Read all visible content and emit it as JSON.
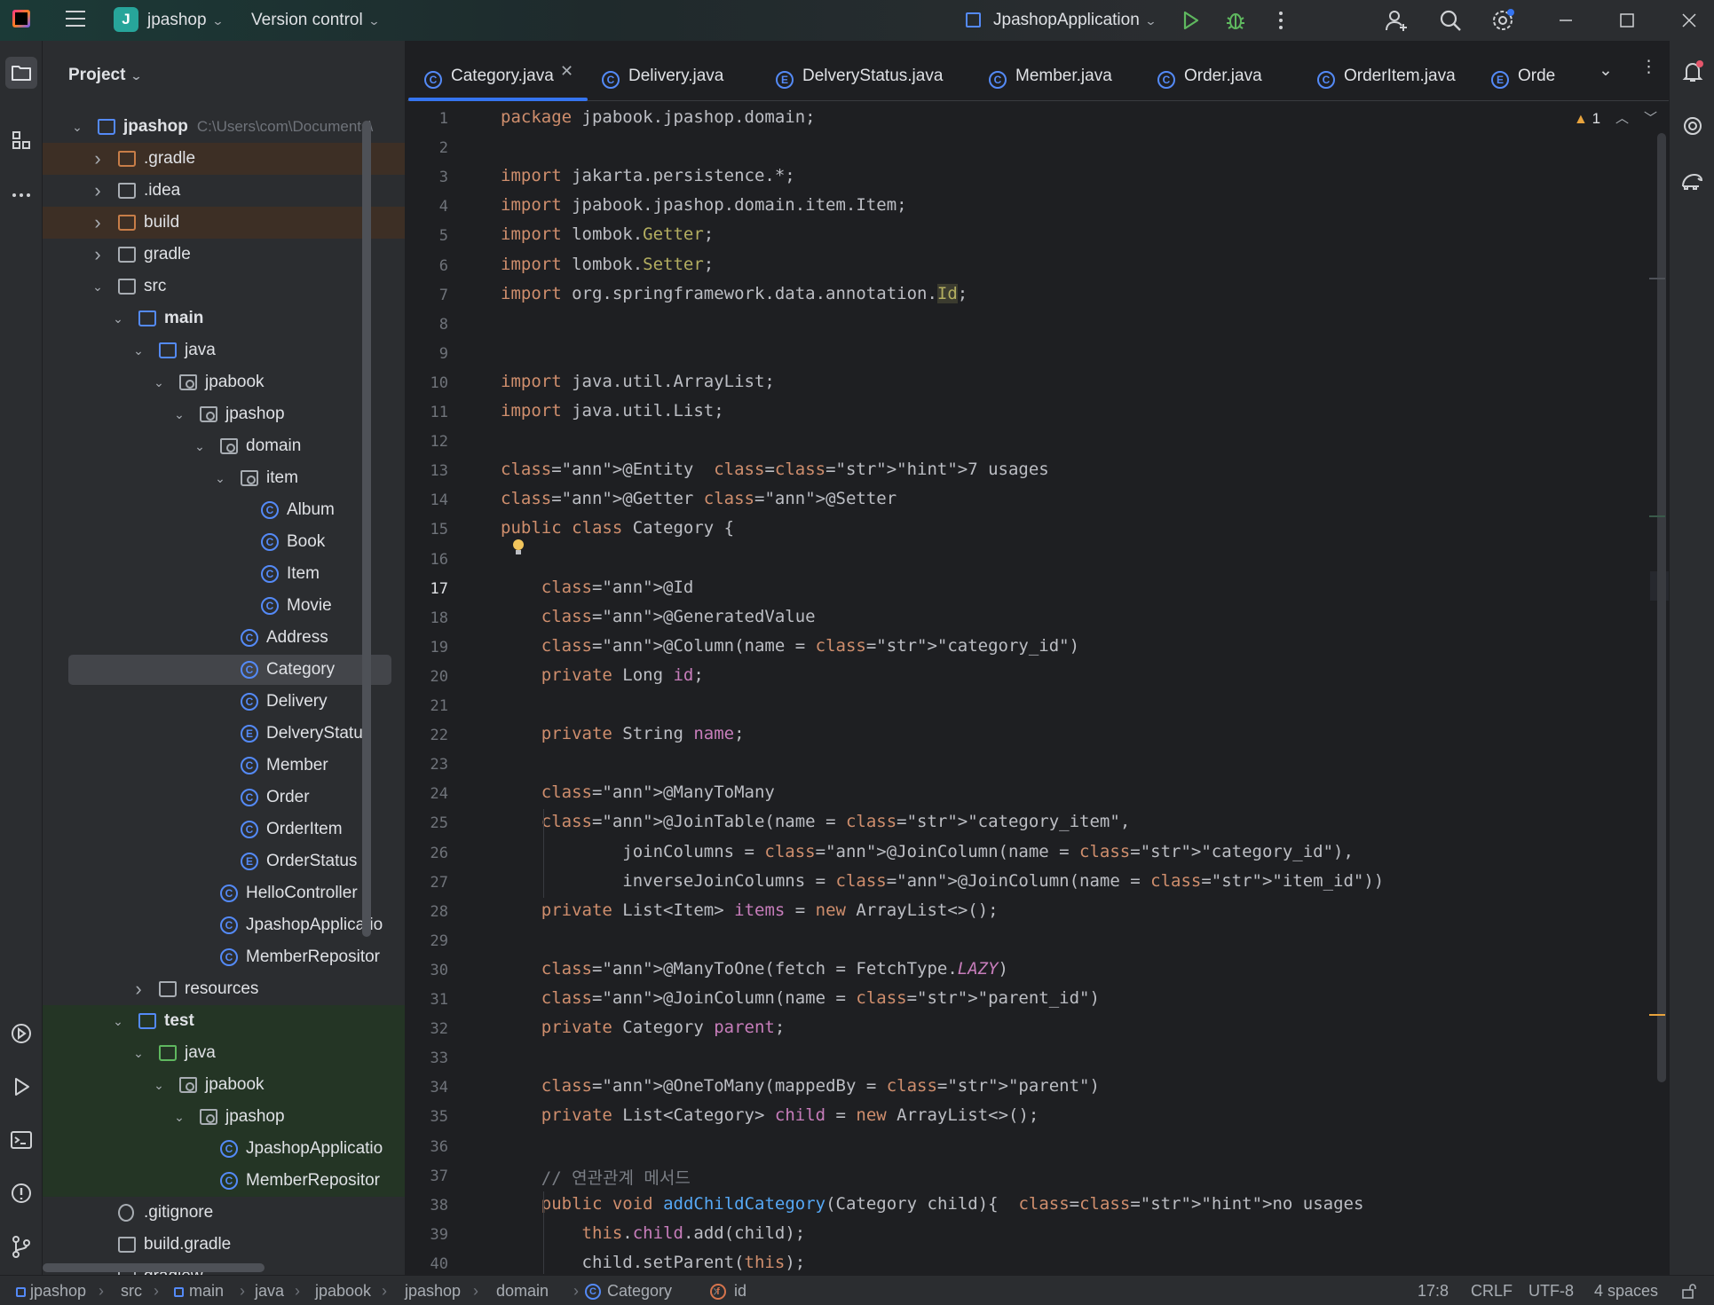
{
  "titlebar": {
    "project_badge": "J",
    "project_name": "jpashop",
    "version_control": "Version control",
    "run_config": "JpashopApplication"
  },
  "project_panel": {
    "title": "Project",
    "root_name": "jpashop",
    "root_path": "C:\\Users\\com\\Documents\\",
    "tree": [
      {
        "label": ".gradle",
        "depth": 1,
        "icon": "folder",
        "arrow": ">",
        "style": "excluded"
      },
      {
        "label": ".idea",
        "depth": 1,
        "icon": "folder",
        "arrow": ">"
      },
      {
        "label": "build",
        "depth": 1,
        "icon": "folder",
        "arrow": ">",
        "style": "excluded"
      },
      {
        "label": "gradle",
        "depth": 1,
        "icon": "folder",
        "arrow": ">"
      },
      {
        "label": "src",
        "depth": 1,
        "icon": "folder",
        "arrow": "v"
      },
      {
        "label": "main",
        "depth": 2,
        "icon": "module",
        "arrow": "v",
        "bold": true
      },
      {
        "label": "java",
        "depth": 3,
        "icon": "folder-blue",
        "arrow": "v"
      },
      {
        "label": "jpabook",
        "depth": 4,
        "icon": "package",
        "arrow": "v"
      },
      {
        "label": "jpashop",
        "depth": 5,
        "icon": "package",
        "arrow": "v"
      },
      {
        "label": "domain",
        "depth": 6,
        "icon": "package",
        "arrow": "v"
      },
      {
        "label": "item",
        "depth": 7,
        "icon": "package",
        "arrow": "v"
      },
      {
        "label": "Album",
        "depth": 8,
        "icon": "class"
      },
      {
        "label": "Book",
        "depth": 8,
        "icon": "class"
      },
      {
        "label": "Item",
        "depth": 8,
        "icon": "class"
      },
      {
        "label": "Movie",
        "depth": 8,
        "icon": "class"
      },
      {
        "label": "Address",
        "depth": 7,
        "icon": "class"
      },
      {
        "label": "Category",
        "depth": 7,
        "icon": "class",
        "style": "selected"
      },
      {
        "label": "Delivery",
        "depth": 7,
        "icon": "class"
      },
      {
        "label": "DelveryStatus",
        "depth": 7,
        "icon": "enum"
      },
      {
        "label": "Member",
        "depth": 7,
        "icon": "class"
      },
      {
        "label": "Order",
        "depth": 7,
        "icon": "class"
      },
      {
        "label": "OrderItem",
        "depth": 7,
        "icon": "class"
      },
      {
        "label": "OrderStatus",
        "depth": 7,
        "icon": "enum"
      },
      {
        "label": "HelloController",
        "depth": 6,
        "icon": "class"
      },
      {
        "label": "JpashopApplicatio",
        "depth": 6,
        "icon": "class"
      },
      {
        "label": "MemberRepositor",
        "depth": 6,
        "icon": "class"
      },
      {
        "label": "resources",
        "depth": 3,
        "icon": "folder",
        "arrow": ">"
      },
      {
        "label": "test",
        "depth": 2,
        "icon": "module",
        "arrow": "v",
        "bold": true,
        "style": "test"
      },
      {
        "label": "java",
        "depth": 3,
        "icon": "folder-green",
        "arrow": "v",
        "style": "test"
      },
      {
        "label": "jpabook",
        "depth": 4,
        "icon": "package",
        "arrow": "v",
        "style": "test"
      },
      {
        "label": "jpashop",
        "depth": 5,
        "icon": "package",
        "arrow": "v",
        "style": "test"
      },
      {
        "label": "JpashopApplicatio",
        "depth": 6,
        "icon": "testclass",
        "style": "test"
      },
      {
        "label": "MemberRepositor",
        "depth": 6,
        "icon": "testclass",
        "style": "test"
      },
      {
        "label": ".gitignore",
        "depth": 1,
        "icon": "ignore"
      },
      {
        "label": "build.gradle",
        "depth": 1,
        "icon": "gradle"
      },
      {
        "label": "gradlew",
        "depth": 1,
        "icon": "file"
      }
    ]
  },
  "editor": {
    "tabs": [
      {
        "label": "Category.java",
        "icon": "C",
        "active": true
      },
      {
        "label": "Delivery.java",
        "icon": "C"
      },
      {
        "label": "DelveryStatus.java",
        "icon": "E"
      },
      {
        "label": "Member.java",
        "icon": "C"
      },
      {
        "label": "Order.java",
        "icon": "C"
      },
      {
        "label": "OrderItem.java",
        "icon": "C"
      },
      {
        "label": "Orde",
        "icon": "E"
      }
    ],
    "inspection_count": "1",
    "current_line": 17,
    "lines": [
      "package jpabook.jpashop.domain;",
      "",
      "import jakarta.persistence.*;",
      "import jpabook.jpashop.domain.item.Item;",
      "import lombok.Getter;",
      "import lombok.Setter;",
      "import org.springframework.data.annotation.Id;",
      "",
      "",
      "import java.util.ArrayList;",
      "import java.util.List;",
      "",
      "@Entity  7 usages",
      "@Getter @Setter",
      "public class Category {",
      "",
      "    @Id",
      "    @GeneratedValue",
      "    @Column(name = \"category_id\")",
      "    private Long id;",
      "",
      "    private String name;",
      "",
      "    @ManyToMany",
      "    @JoinTable(name = \"category_item\",",
      "            joinColumns = @JoinColumn(name = \"category_id\"),",
      "            inverseJoinColumns = @JoinColumn(name = \"item_id\"))",
      "    private List<Item> items = new ArrayList<>();",
      "",
      "    @ManyToOne(fetch = FetchType.LAZY)",
      "    @JoinColumn(name = \"parent_id\")",
      "    private Category parent;",
      "",
      "    @OneToMany(mappedBy = \"parent\")",
      "    private List<Category> child = new ArrayList<>();",
      "",
      "    // 연관관계 메서드",
      "    public void addChildCategory(Category child){  no usages",
      "        this.child.add(child);",
      "        child.setParent(this);"
    ]
  },
  "statusbar": {
    "breadcrumbs": [
      "jpashop",
      "src",
      "main",
      "java",
      "jpabook",
      "jpashop",
      "domain",
      "Category",
      "id"
    ],
    "position": "17:8",
    "line_ending": "CRLF",
    "encoding": "UTF-8",
    "indent": "4 spaces"
  }
}
